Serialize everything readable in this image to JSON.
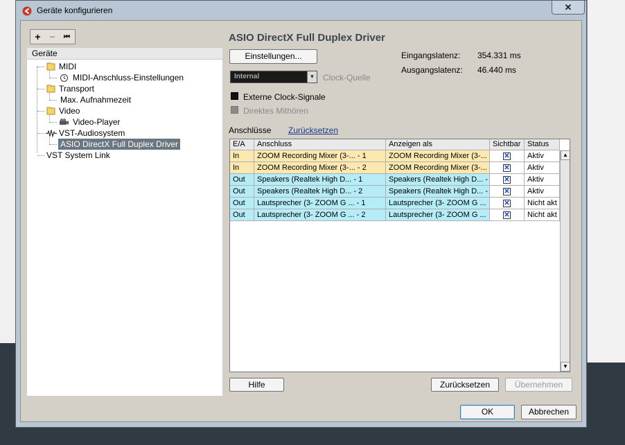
{
  "window": {
    "title": "Geräte konfigurieren",
    "close_symbol": "✕"
  },
  "toolbar": {
    "add": "+",
    "remove": "−",
    "reset": "⏮"
  },
  "devices": {
    "header": "Geräte",
    "items": [
      {
        "label": "MIDI",
        "icon": "folder-icon"
      },
      {
        "label": "MIDI-Anschluss-Einstellungen",
        "icon": "clock-icon"
      },
      {
        "label": "Transport",
        "icon": "folder-icon"
      },
      {
        "label": "Max. Aufnahmezeit",
        "icon": ""
      },
      {
        "label": "Video",
        "icon": "folder-icon"
      },
      {
        "label": "Video-Player",
        "icon": "video-icon"
      },
      {
        "label": "VST-Audiosystem",
        "icon": "audio-icon"
      },
      {
        "label": "ASIO DirectX Full Duplex Driver",
        "icon": "",
        "selected": true
      },
      {
        "label": "VST System Link",
        "icon": ""
      }
    ]
  },
  "driver": {
    "title": "ASIO DirectX Full Duplex Driver",
    "settings_button": "Einstellungen...",
    "input_latency_label": "Eingangslatenz:",
    "input_latency_value": "354.331 ms",
    "output_latency_label": "Ausgangslatenz:",
    "output_latency_value": "46.440 ms",
    "clock_source_value": "Internal",
    "clock_source_label": "Clock-Quelle",
    "external_clock_label": "Externe Clock-Signale",
    "direct_monitoring_label": "Direktes Mithören"
  },
  "ports": {
    "tab_label": "Anschlüsse",
    "reset_link": "Zurücksetzen",
    "columns": [
      "E/A",
      "Anschluss",
      "Anzeigen als",
      "Sichtbar",
      "Status"
    ],
    "rows": [
      {
        "io": "In",
        "port": "ZOOM Recording Mixer (3-... - 1",
        "display": "ZOOM Recording Mixer (3-...",
        "visible": "✕",
        "status": "Aktiv"
      },
      {
        "io": "In",
        "port": "ZOOM Recording Mixer (3-... - 2",
        "display": "ZOOM Recording Mixer (3-...",
        "visible": "✕",
        "status": "Aktiv"
      },
      {
        "io": "Out",
        "port": "Speakers (Realtek High D... - 1",
        "display": "Speakers (Realtek High D... -",
        "visible": "✕",
        "status": "Aktiv"
      },
      {
        "io": "Out",
        "port": "Speakers (Realtek High D... - 2",
        "display": "Speakers (Realtek High D... -",
        "visible": "✕",
        "status": "Aktiv"
      },
      {
        "io": "Out",
        "port": "Lautsprecher (3- ZOOM G ... - 1",
        "display": "Lautsprecher (3- ZOOM G ...",
        "visible": "✕",
        "status": "Nicht akt"
      },
      {
        "io": "Out",
        "port": "Lautsprecher (3- ZOOM G ... - 2",
        "display": "Lautsprecher (3- ZOOM G ...",
        "visible": "✕",
        "status": "Nicht akt"
      }
    ],
    "colors": {
      "in_row": "#fde8b0",
      "out_row": "#b6ecf8"
    }
  },
  "buttons": {
    "help": "Hilfe",
    "reset": "Zurücksetzen",
    "apply": "Übernehmen",
    "ok": "OK",
    "cancel": "Abbrechen"
  }
}
